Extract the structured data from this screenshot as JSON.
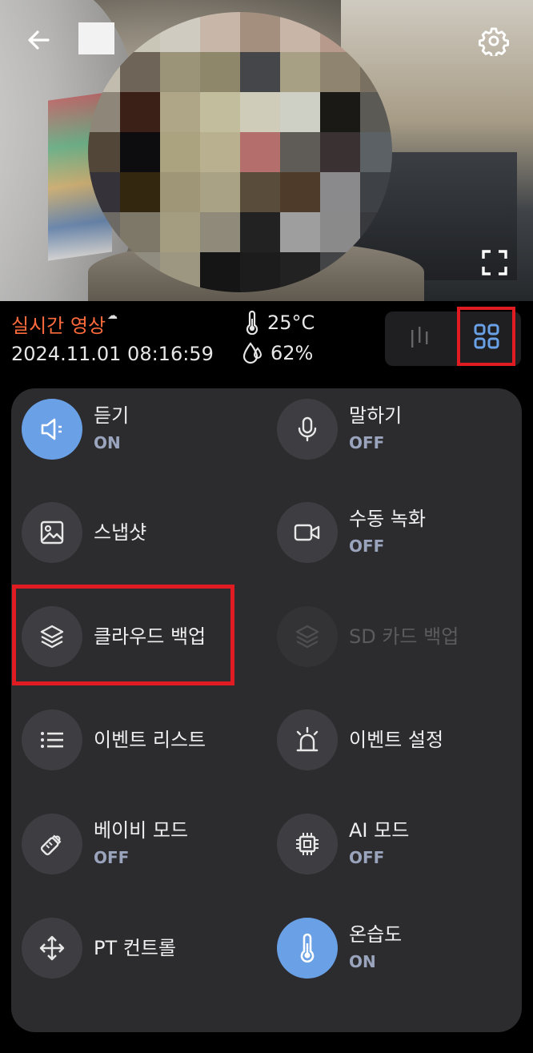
{
  "header": {
    "back_icon": "arrow-left-icon",
    "settings_icon": "gear-icon",
    "fullscreen_icon": "fullscreen-icon"
  },
  "status": {
    "live_label": "실시간 영상",
    "timestamp": "2024.11.01 08:16:59",
    "temperature": "25°C",
    "humidity": "62%"
  },
  "view_toggle": {
    "options": [
      "bars-view",
      "grid-view"
    ],
    "selected": "grid-view"
  },
  "controls": {
    "listen": {
      "label": "듣기",
      "state": "ON",
      "icon": "speaker-icon"
    },
    "talk": {
      "label": "말하기",
      "state": "OFF",
      "icon": "microphone-icon"
    },
    "snapshot": {
      "label": "스냅샷",
      "icon": "image-icon"
    },
    "manual_record": {
      "label": "수동 녹화",
      "state": "OFF",
      "icon": "video-camera-icon"
    },
    "cloud_backup": {
      "label": "클라우드 백업",
      "icon": "layers-icon"
    },
    "sd_backup": {
      "label": "SD 카드 백업",
      "icon": "layers-icon",
      "disabled": true
    },
    "event_list": {
      "label": "이벤트 리스트",
      "icon": "list-icon"
    },
    "event_settings": {
      "label": "이벤트 설정",
      "icon": "alarm-light-icon"
    },
    "baby_mode": {
      "label": "베이비 모드",
      "state": "OFF",
      "icon": "baby-bottle-icon"
    },
    "ai_mode": {
      "label": "AI 모드",
      "state": "OFF",
      "icon": "chip-icon"
    },
    "pt_control": {
      "label": "PT 컨트롤",
      "icon": "move-arrows-icon"
    },
    "temp_humidity": {
      "label": "온습도",
      "state": "ON",
      "icon": "thermometer-icon"
    }
  },
  "colors": {
    "live_label": "#ff6b3d",
    "active_circle": "#6aa0e6",
    "highlight": "#e11b22",
    "panel_bg": "#2c2c2f"
  }
}
